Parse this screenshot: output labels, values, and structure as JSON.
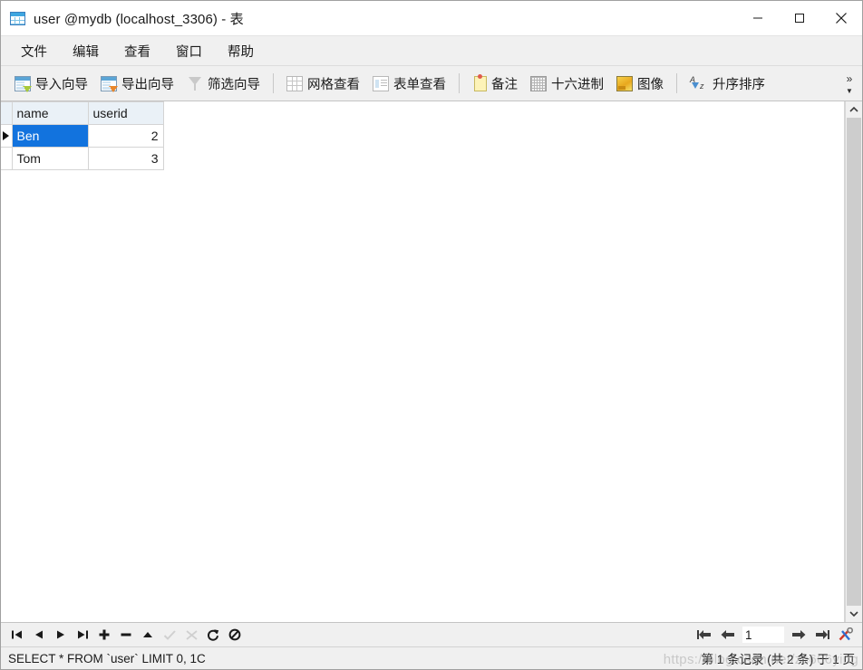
{
  "window": {
    "title": "user @mydb (localhost_3306) - 表",
    "app_icon": "table-icon",
    "minimize_label": "—",
    "maximize_label": "□",
    "close_label": "✕"
  },
  "menubar": {
    "items": [
      {
        "label": "文件",
        "name": "menu-file"
      },
      {
        "label": "编辑",
        "name": "menu-edit"
      },
      {
        "label": "查看",
        "name": "menu-view"
      },
      {
        "label": "窗口",
        "name": "menu-window"
      },
      {
        "label": "帮助",
        "name": "menu-help"
      }
    ]
  },
  "toolbar": {
    "items": [
      {
        "label": "导入向导",
        "icon": "import-wizard-icon"
      },
      {
        "label": "导出向导",
        "icon": "export-wizard-icon"
      },
      {
        "label": "筛选向导",
        "icon": "filter-wizard-icon"
      },
      {
        "label": "网格查看",
        "icon": "grid-view-icon"
      },
      {
        "label": "表单查看",
        "icon": "form-view-icon"
      },
      {
        "label": "备注",
        "icon": "memo-icon"
      },
      {
        "label": "十六进制",
        "icon": "hex-icon"
      },
      {
        "label": "图像",
        "icon": "image-icon"
      },
      {
        "label": "升序排序",
        "icon": "sort-ascending-icon"
      }
    ],
    "overflow_label": "»",
    "overflow_arrow": "▼"
  },
  "grid": {
    "columns": [
      "name",
      "userid"
    ],
    "rows": [
      {
        "name": "Ben",
        "userid": "2",
        "selected": true
      },
      {
        "name": "Tom",
        "userid": "3",
        "selected": false
      }
    ],
    "selection_color": "#1273de",
    "header_color": "#eaf1f7"
  },
  "record_nav": {
    "buttons": [
      {
        "name": "first-record-button",
        "icon": "first-record-icon"
      },
      {
        "name": "previous-record-button",
        "icon": "previous-record-icon"
      },
      {
        "name": "next-record-button",
        "icon": "next-record-icon"
      },
      {
        "name": "last-record-button",
        "icon": "last-record-icon"
      },
      {
        "name": "add-record-button",
        "icon": "plus-icon"
      },
      {
        "name": "delete-record-button",
        "icon": "minus-icon"
      },
      {
        "name": "edit-record-button",
        "icon": "up-triangle-icon"
      },
      {
        "name": "apply-changes-button",
        "icon": "check-icon"
      },
      {
        "name": "discard-changes-button",
        "icon": "scissors-icon"
      },
      {
        "name": "refresh-button",
        "icon": "refresh-icon"
      },
      {
        "name": "stop-button",
        "icon": "stop-icon"
      }
    ],
    "page_first": "first-page-icon",
    "page_prev": "previous-page-icon",
    "page_value": "1",
    "page_next": "next-page-icon",
    "page_last": "last-page-icon",
    "tools": "tools-icon"
  },
  "statusbar": {
    "sql": "SELECT * FROM `user` LIMIT 0, 1C",
    "record_info": "第 1 条记录 (共 2 条) 于 1 页",
    "watermark": "https://blog.csdn.net/zc666ying"
  }
}
